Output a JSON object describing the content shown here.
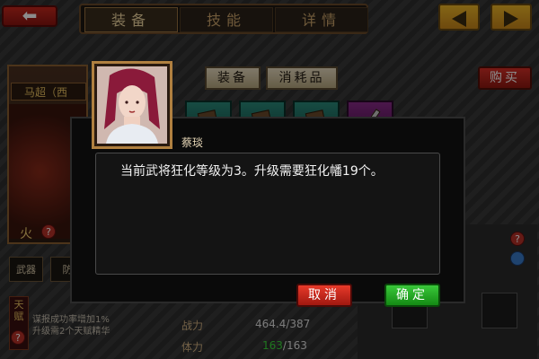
{
  "nav": {
    "back_icon": "back-arrow-icon"
  },
  "tabs": [
    {
      "label": "装备"
    },
    {
      "label": "技能"
    },
    {
      "label": "详情"
    }
  ],
  "hero": {
    "name": "马超（西",
    "element": "火"
  },
  "slots": {
    "weapon": "武器",
    "defense": "防"
  },
  "sub_tabs": [
    {
      "label": "装备"
    },
    {
      "label": "消耗品"
    }
  ],
  "buy_label": "购买",
  "talent": {
    "label": "天赋",
    "desc_line1": "谋报成功率增加1%",
    "desc_line2": "升级需2个天赋精华"
  },
  "stats": {
    "power_label": "战力",
    "power_value": "464.4/387",
    "hp_label": "体力",
    "hp_current": "163",
    "hp_max": "/163"
  },
  "dialog": {
    "speaker": "蔡琰",
    "message": "当前武将狂化等级为3。升级需要狂化幡19个。",
    "cancel_label": "取消",
    "confirm_label": "确定"
  },
  "colors": {
    "accent_gold": "#f0b828",
    "confirm_green": "#2aa82a",
    "cancel_red": "#d02a1c",
    "hp_green": "#3ad83a"
  }
}
